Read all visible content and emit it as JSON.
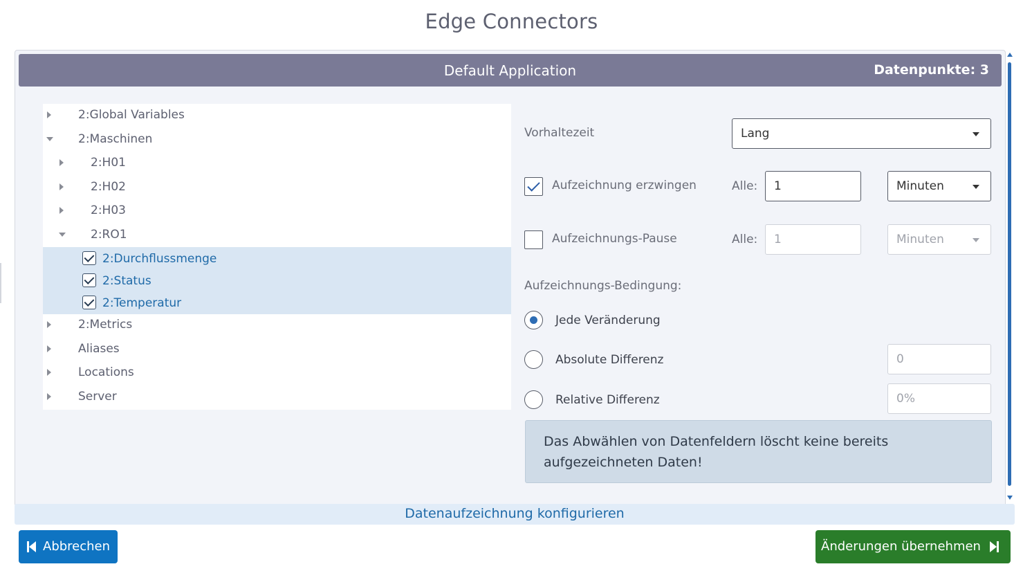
{
  "page": {
    "title": "Edge Connectors"
  },
  "app": {
    "name": "Default Application",
    "datapoints": "Datenpunkte: 3"
  },
  "tree": {
    "nodes": [
      {
        "label": "2:Global Variables",
        "expanded": false
      },
      {
        "label": "2:Maschinen",
        "expanded": true
      },
      {
        "label": "2:H01",
        "expanded": false
      },
      {
        "label": "2:H02",
        "expanded": false
      },
      {
        "label": "2:H03",
        "expanded": false
      },
      {
        "label": "2:RO1",
        "expanded": true
      }
    ],
    "leaves": [
      {
        "label": "2:Durchflussmenge",
        "checked": true
      },
      {
        "label": "2:Status",
        "checked": true
      },
      {
        "label": "2:Temperatur",
        "checked": true
      }
    ],
    "after": [
      {
        "label": "2:Metrics",
        "expanded": false
      },
      {
        "label": "Aliases",
        "expanded": false
      },
      {
        "label": "Locations",
        "expanded": false
      },
      {
        "label": "Server",
        "expanded": false
      }
    ]
  },
  "settings": {
    "retention": {
      "label": "Vorhaltezeit",
      "value": "Lang"
    },
    "force": {
      "label": "Aufzeichnung erzwingen",
      "checked": true,
      "every_label": "Alle:",
      "value": "1",
      "unit": "Minuten"
    },
    "pause": {
      "label": "Aufzeichnungs-Pause",
      "checked": false,
      "every_label": "Alle:",
      "value": "1",
      "unit": "Minuten"
    },
    "condition": {
      "label": "Aufzeichnungs-Bedingung:",
      "options": [
        {
          "label": "Jede Veränderung",
          "checked": true
        },
        {
          "label": "Absolute Differenz",
          "checked": false,
          "placeholder": "0"
        },
        {
          "label": "Relative Differenz",
          "checked": false,
          "placeholder": "0%"
        }
      ]
    },
    "info": "Das Abwählen von Datenfeldern löscht keine bereits aufgezeichneten Daten!"
  },
  "footer": {
    "section_label": "Datenaufzeichnung konfigurieren",
    "cancel_label": "Abbrechen",
    "apply_label": "Änderungen übernehmen"
  },
  "colors": {
    "header": "#7a7a96",
    "primary": "#0f74c2",
    "success": "#2a7d2a",
    "link": "#1f6aa8"
  }
}
